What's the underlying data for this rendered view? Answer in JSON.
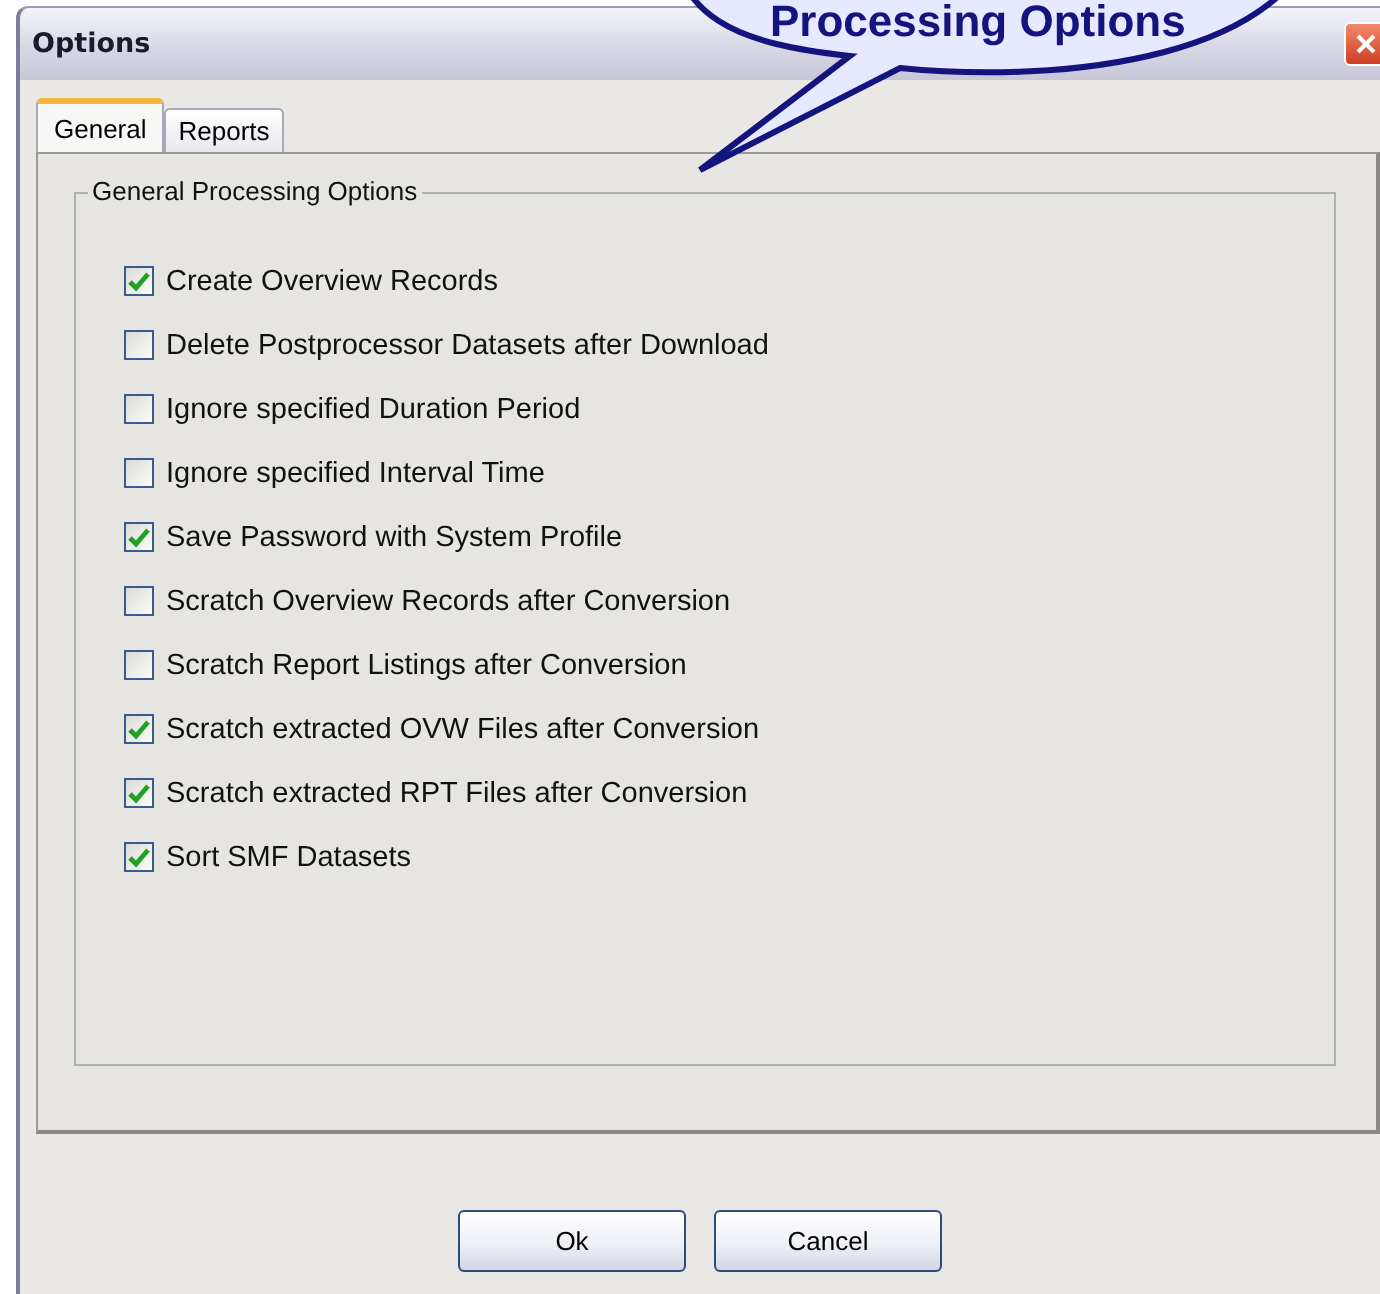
{
  "window": {
    "title": "Options"
  },
  "callout": {
    "text": "Processing Options"
  },
  "tabs": [
    {
      "label": "General",
      "selected": true
    },
    {
      "label": "Reports",
      "selected": false
    }
  ],
  "group": {
    "title": "General Processing Options"
  },
  "options": [
    {
      "label": "Create Overview Records",
      "checked": true
    },
    {
      "label": "Delete Postprocessor Datasets after Download",
      "checked": false
    },
    {
      "label": "Ignore specified Duration Period",
      "checked": false
    },
    {
      "label": "Ignore specified Interval Time",
      "checked": false
    },
    {
      "label": "Save Password with System Profile",
      "checked": true
    },
    {
      "label": "Scratch Overview Records after Conversion",
      "checked": false
    },
    {
      "label": "Scratch Report Listings after Conversion",
      "checked": false
    },
    {
      "label": "Scratch extracted OVW Files after Conversion",
      "checked": true
    },
    {
      "label": "Scratch extracted RPT Files after Conversion",
      "checked": true
    },
    {
      "label": "Sort SMF Datasets",
      "checked": true
    }
  ],
  "buttons": [
    "Ok",
    "Cancel"
  ]
}
